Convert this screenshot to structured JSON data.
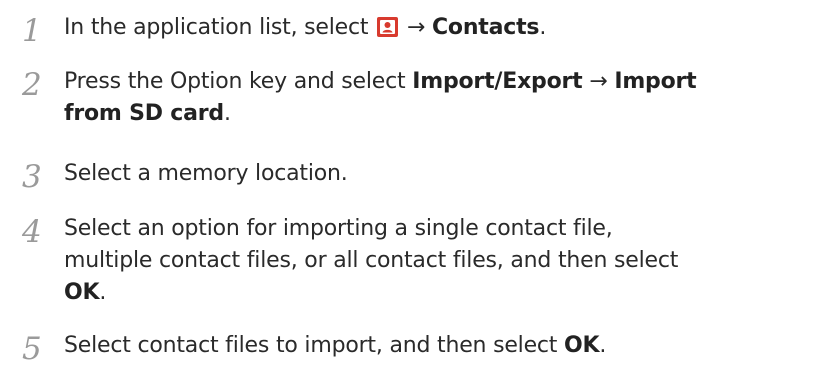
{
  "steps": [
    {
      "number": "1",
      "pre": "In the application list, select ",
      "icon": "contacts-app-icon",
      "arrow": " → ",
      "bold": "Contacts",
      "post": "."
    },
    {
      "number": "2",
      "pre": "Press the Option key and select ",
      "bold1": "Import/Export",
      "arrow": " → ",
      "bold2a": "Import",
      "bold2b": "from SD card",
      "post": "."
    },
    {
      "number": "3",
      "text": "Select a memory location."
    },
    {
      "number": "4",
      "line1": "Select an option for importing a single contact file,",
      "line2": "multiple contact files, or all contact files, and then select",
      "bold": "OK",
      "post": "."
    },
    {
      "number": "5",
      "pre": "Select contact files to import, and then select ",
      "bold": "OK",
      "post": "."
    }
  ],
  "colors": {
    "text": "#2a2a2a",
    "step_number": "#9a9a9a",
    "icon_red": "#d83a2e"
  }
}
